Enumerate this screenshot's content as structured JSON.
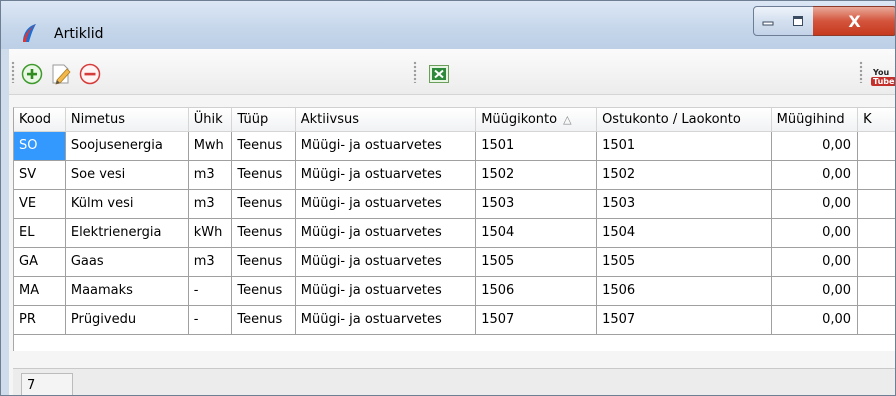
{
  "window": {
    "title": "Artiklid",
    "close_glyph": "X"
  },
  "toolbar": {
    "icons": [
      "add-icon",
      "edit-icon",
      "remove-icon",
      "excel-export-icon",
      "youtube-icon"
    ],
    "youtube_label_top": "You",
    "youtube_label_bottom": "Tube"
  },
  "table": {
    "columns": [
      "Kood",
      "Nimetus",
      "Ühik",
      "Tüüp",
      "Aktiivsus",
      "Müügikonto",
      "Ostukonto / Laokonto",
      "Müügihind",
      "K"
    ],
    "sort_indicator": "△",
    "rows": [
      [
        "SO",
        "Soojusenergia",
        "Mwh",
        "Teenus",
        "Müügi- ja ostuarvetes",
        "1501",
        "1501",
        "0,00"
      ],
      [
        "SV",
        "Soe vesi",
        "m3",
        "Teenus",
        "Müügi- ja ostuarvetes",
        "1502",
        "1502",
        "0,00"
      ],
      [
        "VE",
        "Külm vesi",
        "m3",
        "Teenus",
        "Müügi- ja ostuarvetes",
        "1503",
        "1503",
        "0,00"
      ],
      [
        "EL",
        "Elektrienergia",
        "kWh",
        "Teenus",
        "Müügi- ja ostuarvetes",
        "1504",
        "1504",
        "0,00"
      ],
      [
        "GA",
        "Gaas",
        "m3",
        "Teenus",
        "Müügi- ja ostuarvetes",
        "1505",
        "1505",
        "0,00"
      ],
      [
        "MA",
        "Maamaks",
        "-",
        "Teenus",
        "Müügi- ja ostuarvetes",
        "1506",
        "1506",
        "0,00"
      ],
      [
        "PR",
        "Prügivedu",
        "-",
        "Teenus",
        "Müügi- ja ostuarvetes",
        "1507",
        "1507",
        "0,00"
      ]
    ],
    "selected_cell": {
      "row": 0,
      "col": 0
    }
  },
  "footer": {
    "row_count": "7"
  },
  "colors": {
    "selection": "#3399ff",
    "close_button": "#c63a1f"
  }
}
